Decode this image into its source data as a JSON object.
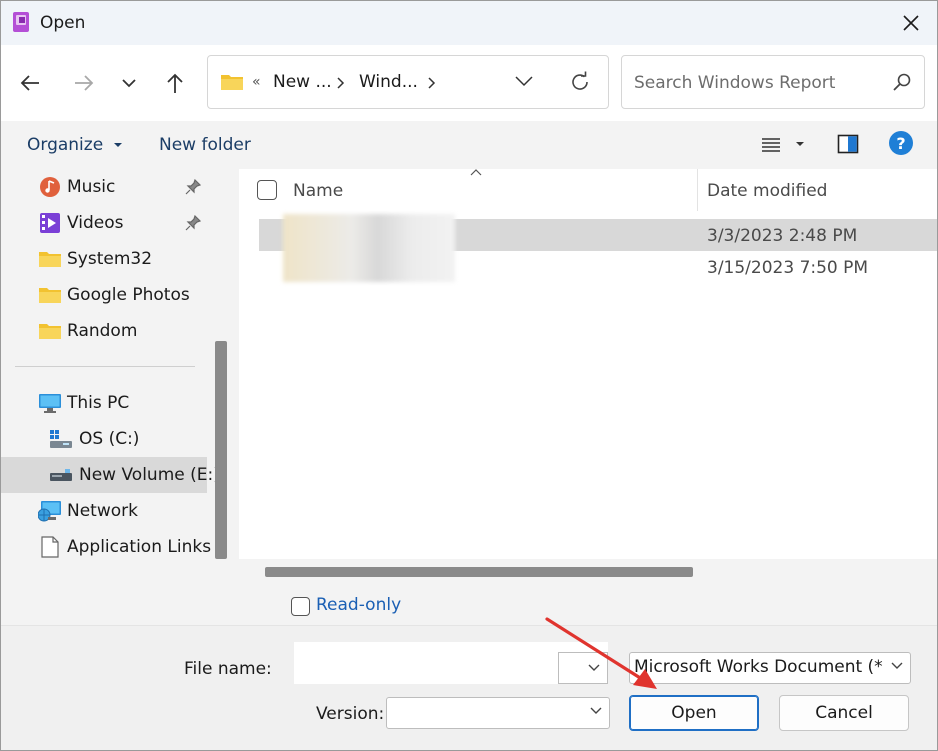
{
  "window": {
    "title": "Open",
    "accent": "#0067c0"
  },
  "nav": {
    "breadcrumb": [
      {
        "label": "«"
      },
      {
        "label": "New ..."
      },
      {
        "label": "Wind..."
      }
    ],
    "search_placeholder": "Search Windows Report"
  },
  "toolbar": {
    "organize_label": "Organize",
    "new_folder_label": "New folder"
  },
  "sidebar": {
    "items": [
      {
        "label": "Music",
        "icon": "music-icon",
        "pinned": true
      },
      {
        "label": "Videos",
        "icon": "videos-icon",
        "pinned": true
      },
      {
        "label": "System32",
        "icon": "folder-icon"
      },
      {
        "label": "Google Photos",
        "icon": "folder-icon"
      },
      {
        "label": "Random",
        "icon": "folder-icon"
      },
      {
        "label": "This PC",
        "icon": "pc-icon"
      },
      {
        "label": "OS (C:)",
        "icon": "drive-icon"
      },
      {
        "label": "New Volume (E:)",
        "icon": "drive-icon",
        "selected": true
      },
      {
        "label": "Network",
        "icon": "network-icon"
      },
      {
        "label": "Application Links",
        "icon": "file-icon"
      }
    ]
  },
  "files": {
    "columns": {
      "name": "Name",
      "date": "Date modified"
    },
    "rows": [
      {
        "date": "3/3/2023 2:48 PM",
        "selected": true
      },
      {
        "date": "3/15/2023 7:50 PM",
        "selected": false
      }
    ]
  },
  "options": {
    "readonly_label": "Read-only"
  },
  "footer": {
    "file_name_label": "File name:",
    "version_label": "Version:",
    "filter_value": "Microsoft Works Document (*.w",
    "open_label": "Open",
    "cancel_label": "Cancel"
  }
}
